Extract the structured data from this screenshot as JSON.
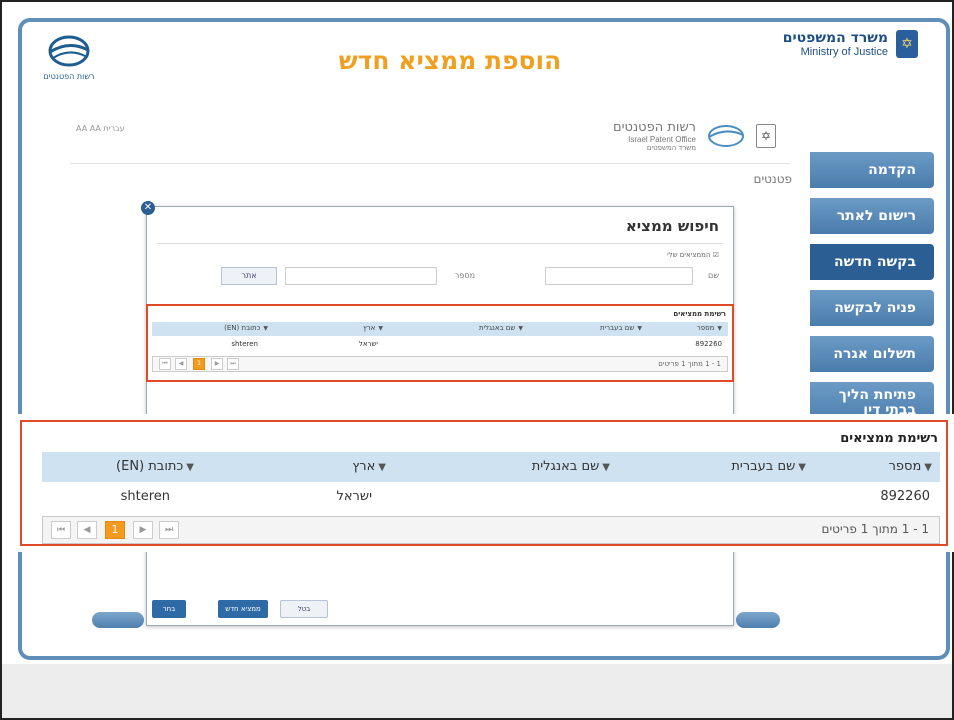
{
  "slide_title": "הוספת ממציא חדש",
  "moj": {
    "name_he": "משרד המשפטים",
    "name_en": "Ministry of Justice"
  },
  "ipo": {
    "caption": "רשות הפטנטים"
  },
  "inner_header": {
    "toolbar_text": "AA AA עברית",
    "ipo_he": "רשות הפטנטים",
    "ipo_en": "Israel Patent Office",
    "ipo_sub": "משרד המשפטים"
  },
  "patents_label": "פטנטים",
  "side_nav": {
    "items": [
      {
        "label": "הקדמה"
      },
      {
        "label": "רישום לאתר"
      },
      {
        "label": "בקשה חדשה"
      },
      {
        "label": "פניה לבקשה"
      },
      {
        "label": "תשלום אגרה"
      },
      {
        "label": "פתיחת הליך בבתי דין"
      }
    ]
  },
  "modal": {
    "title": "חיפוש ממציא",
    "my_inventors_label": "הממציאים שלי",
    "name_label": "שם",
    "number_label": "מספר",
    "search_button": "אתר",
    "buttons": {
      "select": "בחר",
      "new_inventor": "ממציא חדש",
      "cancel": "בטל"
    }
  },
  "inventors_list": {
    "title": "רשימת ממציאים",
    "columns": [
      "מספר",
      "שם בעברית",
      "שם באנגלית",
      "ארץ",
      "כתובת (EN)"
    ],
    "rows": [
      [
        "892260",
        "",
        "",
        "ישראל",
        "shteren"
      ]
    ],
    "pager": {
      "current_page": "1",
      "count_text": "1 - 1 מתוך 1 פריטים"
    }
  }
}
